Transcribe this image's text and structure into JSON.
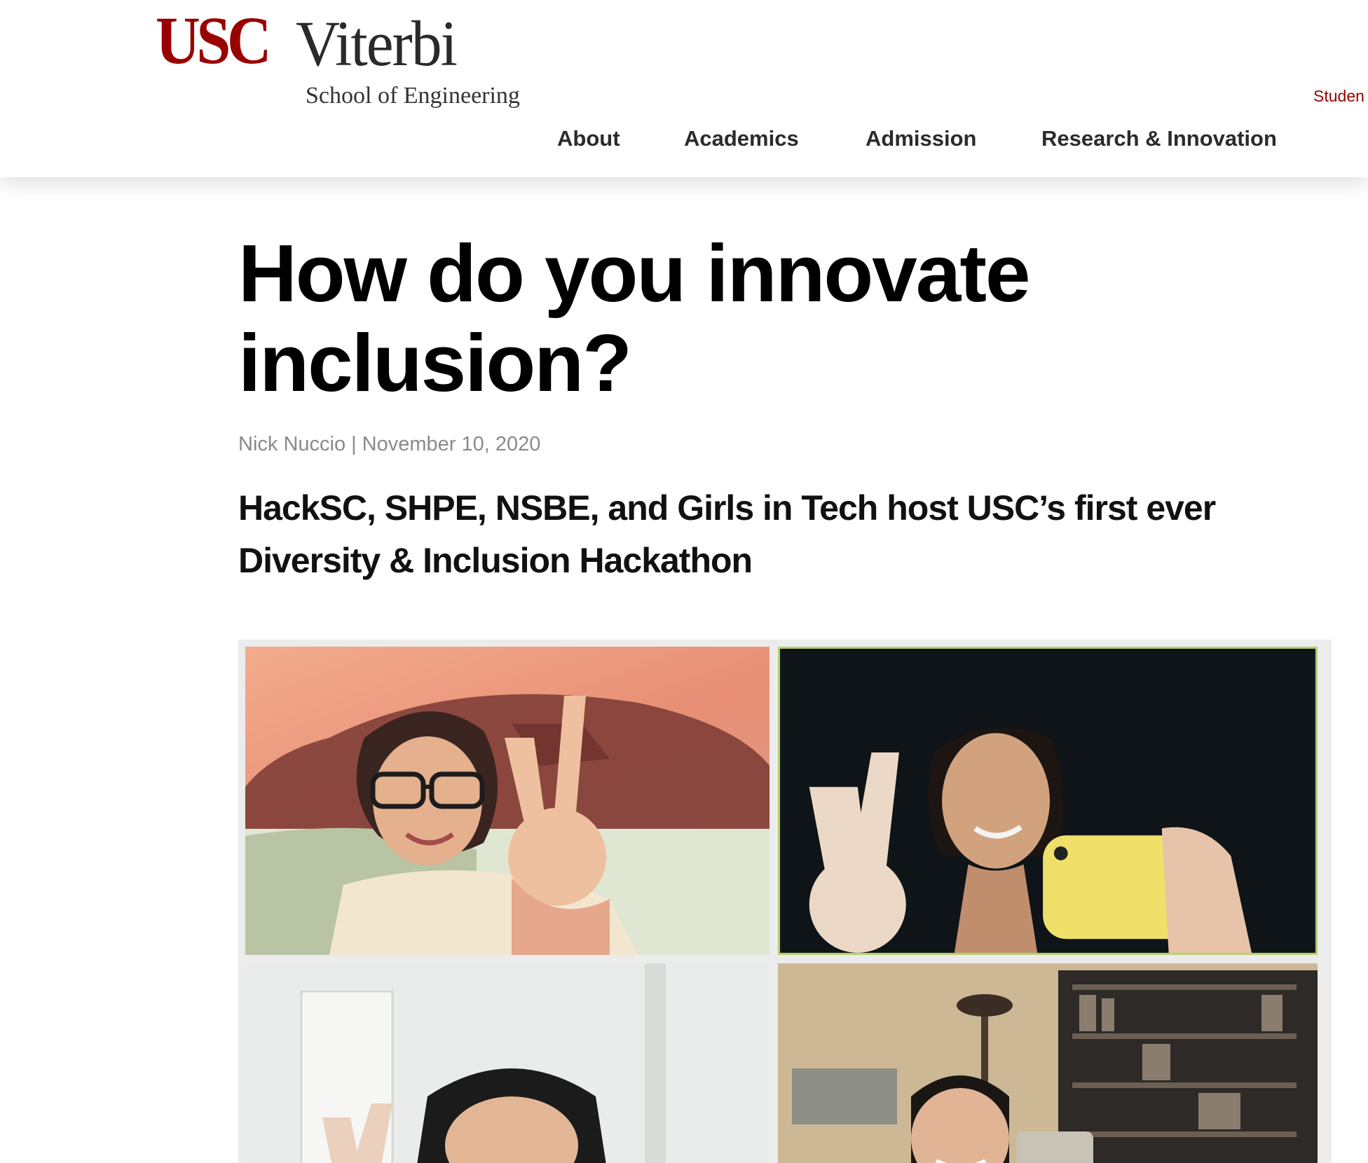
{
  "header": {
    "logo": {
      "primary": "USC",
      "secondary": "Viterbi",
      "tagline": "School of Engineering"
    },
    "utility_link": "Studen",
    "nav": [
      {
        "label": "About"
      },
      {
        "label": "Academics"
      },
      {
        "label": "Admission"
      },
      {
        "label": "Research & Innovation"
      }
    ]
  },
  "article": {
    "title": "How do you innovate inclusion?",
    "author": "Nick Nuccio",
    "separator": "|",
    "date": "November 10, 2020",
    "subtitle": "HackSC, SHPE, NSBE, and Girls in Tech host USC’s first ever Diversity & Inclusion Hackathon"
  },
  "colors": {
    "brand_red": "#990000",
    "text_dark": "#000000",
    "byline_gray": "#8a8a8a"
  }
}
